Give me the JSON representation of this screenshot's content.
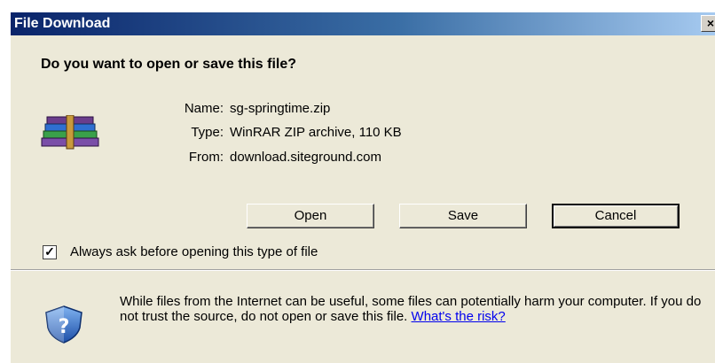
{
  "dialog": {
    "title": "File Download",
    "close_label": "×",
    "question": "Do you want to open or save this file?",
    "file": {
      "icon": "winrar-archive-icon",
      "name_label": "Name:",
      "name_value": "sg-springtime.zip",
      "type_label": "Type:",
      "type_value": "WinRAR ZIP archive, 110 KB",
      "from_label": "From:",
      "from_value": "download.siteground.com"
    },
    "buttons": {
      "open": "Open",
      "save": "Save",
      "cancel": "Cancel"
    },
    "always_ask": {
      "checked": true,
      "mark": "✓",
      "label": "Always ask before opening this type of file"
    },
    "warning": {
      "icon": "security-shield-question-icon",
      "text": "While files from the Internet can be useful, some files can potentially harm your computer. If you do not trust the source, do not open or save this file.",
      "link": "What's the risk?"
    },
    "colors": {
      "titlebar": "#0a246a",
      "dialog_bg": "#ece9d8",
      "link": "#0000ee"
    }
  }
}
